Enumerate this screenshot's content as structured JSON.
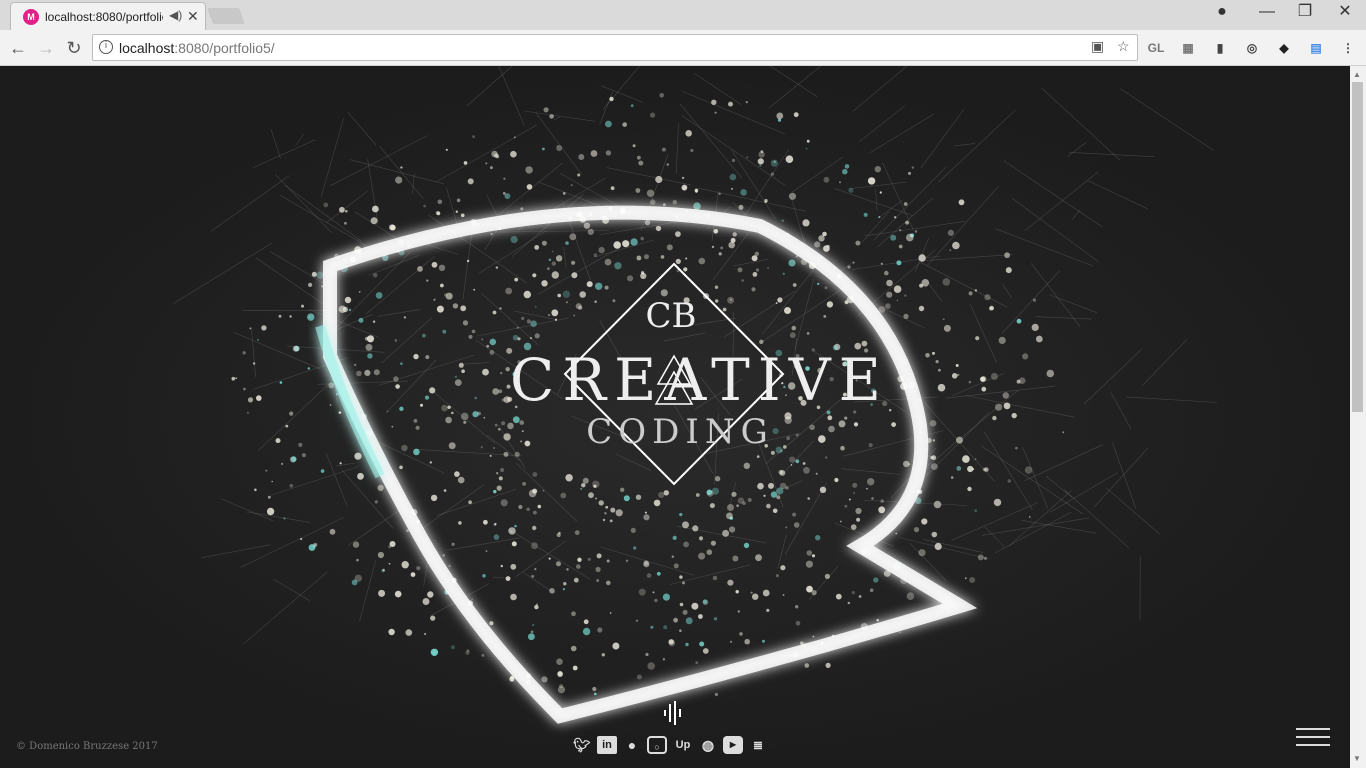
{
  "browser": {
    "tab_title": "localhost:8080/portfolio",
    "url_host": "localhost",
    "url_rest": ":8080/portfolio5/",
    "favicon_letter": "M",
    "extensions": [
      "GL"
    ]
  },
  "page": {
    "logo_mono": "CB",
    "logo_title": "CREATIVE",
    "logo_subtitle": "CODING",
    "copyright": "© Domenico Bruzzese 2017",
    "social": [
      "twitter-icon",
      "linkedin-icon",
      "github-icon",
      "instagram-icon",
      "upwork-icon",
      "dribbble-icon",
      "youtube-icon",
      "stackoverflow-icon"
    ],
    "upwork_label": "Up"
  },
  "colors": {
    "background": "#1c1c1c",
    "particles": "#f4f1e4",
    "glow_cyan": "#7fe8e0",
    "favicon": "#e0218a"
  }
}
